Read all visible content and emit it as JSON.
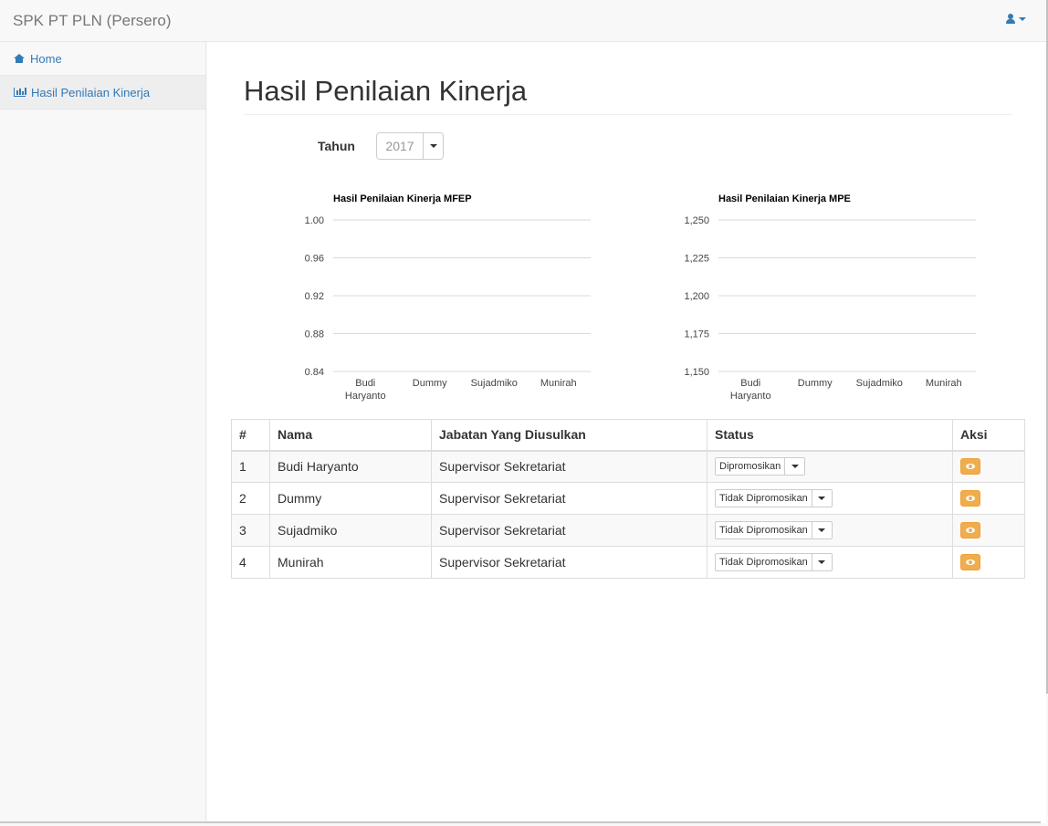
{
  "navbar": {
    "brand": "SPK PT PLN (Persero)",
    "user_icon": "user-icon"
  },
  "sidebar": {
    "items": [
      {
        "label": "Home",
        "icon": "home-icon",
        "active": false
      },
      {
        "label": "Hasil Penilaian Kinerja",
        "icon": "bar-chart-icon",
        "active": true
      }
    ]
  },
  "main": {
    "title": "Hasil Penilaian Kinerja",
    "year": {
      "label": "Tahun",
      "value": "2017"
    }
  },
  "chart_data": [
    {
      "type": "bar",
      "title": "Hasil Penilaian Kinerja MFEP",
      "categories": [
        "Budi Haryanto",
        "Dummy",
        "Sujadmiko",
        "Munirah"
      ],
      "category_lines": [
        [
          "Budi",
          "Haryanto"
        ],
        [
          "Dummy"
        ],
        [
          "Sujadmiko"
        ],
        [
          "Munirah"
        ]
      ],
      "yticks": [
        "1.00",
        "0.96",
        "0.92",
        "0.88",
        "0.84"
      ],
      "ylim": [
        0.84,
        1.0
      ],
      "grid": true
    },
    {
      "type": "bar",
      "title": "Hasil Penilaian Kinerja MPE",
      "categories": [
        "Budi Haryanto",
        "Dummy",
        "Sujadmiko",
        "Munirah"
      ],
      "category_lines": [
        [
          "Budi",
          "Haryanto"
        ],
        [
          "Dummy"
        ],
        [
          "Sujadmiko"
        ],
        [
          "Munirah"
        ]
      ],
      "yticks": [
        "1,250",
        "1,225",
        "1,200",
        "1,175",
        "1,150"
      ],
      "ylim": [
        1150,
        1250
      ],
      "grid": true
    }
  ],
  "table": {
    "headers": [
      "#",
      "Nama",
      "Jabatan Yang Diusulkan",
      "Status",
      "Aksi"
    ],
    "rows": [
      {
        "no": "1",
        "nama": "Budi Haryanto",
        "jabatan": "Supervisor Sekretariat",
        "status": "Dipromosikan"
      },
      {
        "no": "2",
        "nama": "Dummy",
        "jabatan": "Supervisor Sekretariat",
        "status": "Tidak Dipromosikan"
      },
      {
        "no": "3",
        "nama": "Sujadmiko",
        "jabatan": "Supervisor Sekretariat",
        "status": "Tidak Dipromosikan"
      },
      {
        "no": "4",
        "nama": "Munirah",
        "jabatan": "Supervisor Sekretariat",
        "status": "Tidak Dipromosikan"
      }
    ]
  }
}
